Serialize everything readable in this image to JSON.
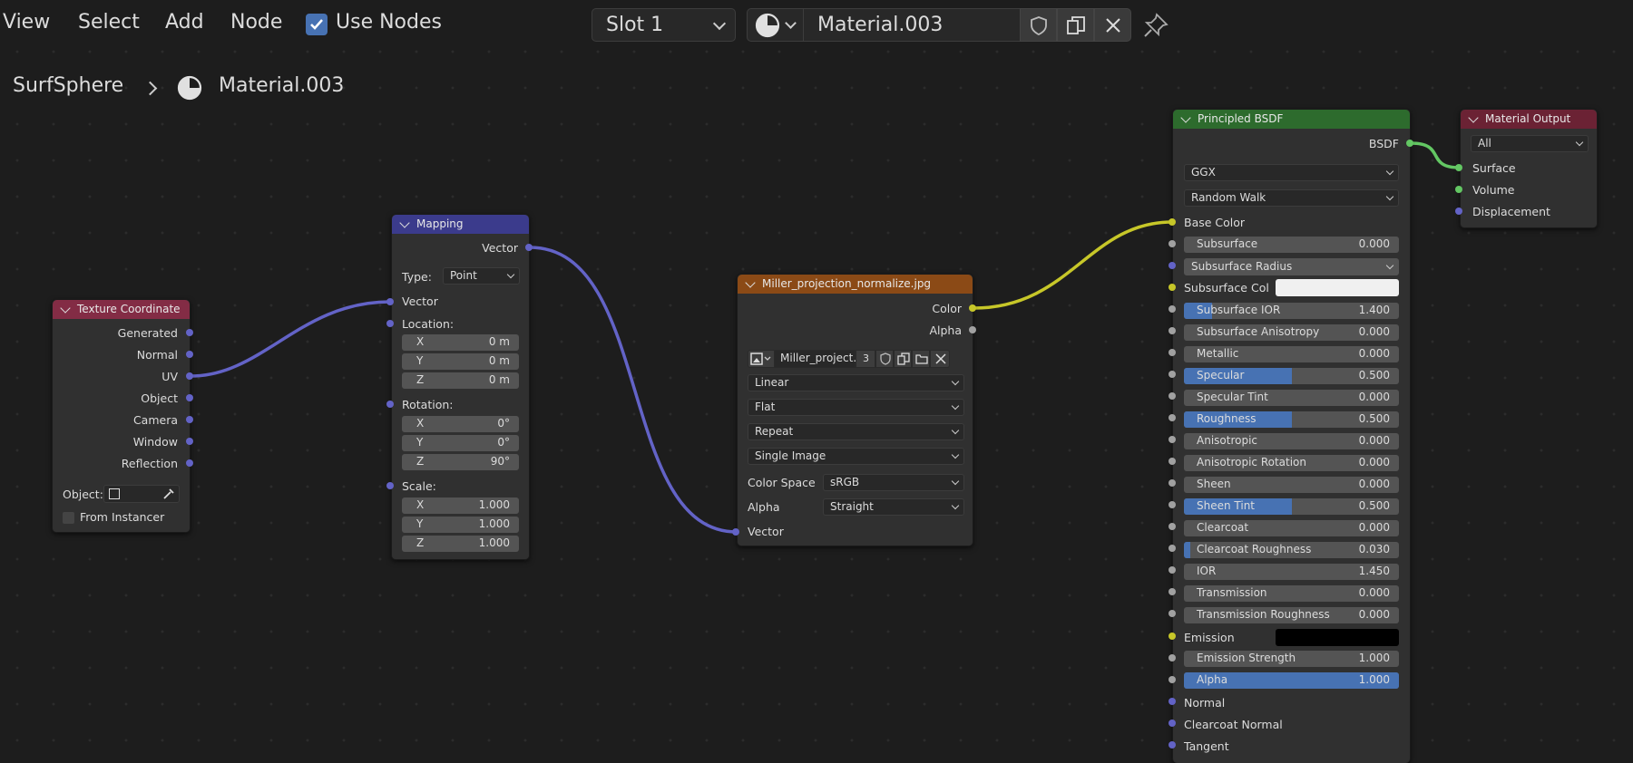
{
  "menu": {
    "view": "View",
    "select": "Select",
    "add": "Add",
    "node": "Node"
  },
  "use_nodes": {
    "label": "Use Nodes",
    "checked": true
  },
  "slot": {
    "label": "Slot 1"
  },
  "material_name": "Material.003",
  "breadcrumb": {
    "object": "SurfSphere",
    "material": "Material.003"
  },
  "nodes": {
    "texcoord": {
      "title": "Texture Coordinate",
      "outputs": [
        "Generated",
        "Normal",
        "UV",
        "Object",
        "Camera",
        "Window",
        "Reflection"
      ],
      "object_label": "Object:",
      "from_instancer": "From Instancer"
    },
    "mapping": {
      "title": "Mapping",
      "output": "Vector",
      "type_label": "Type:",
      "type_value": "Point",
      "vector_in": "Vector",
      "location_label": "Location:",
      "location": [
        {
          "axis": "X",
          "value": "0 m"
        },
        {
          "axis": "Y",
          "value": "0 m"
        },
        {
          "axis": "Z",
          "value": "0 m"
        }
      ],
      "rotation_label": "Rotation:",
      "rotation": [
        {
          "axis": "X",
          "value": "0°"
        },
        {
          "axis": "Y",
          "value": "0°"
        },
        {
          "axis": "Z",
          "value": "90°"
        }
      ],
      "scale_label": "Scale:",
      "scale": [
        {
          "axis": "X",
          "value": "1.000"
        },
        {
          "axis": "Y",
          "value": "1.000"
        },
        {
          "axis": "Z",
          "value": "1.000"
        }
      ]
    },
    "image": {
      "title": "Miller_projection_normalize.jpg",
      "out_color": "Color",
      "out_alpha": "Alpha",
      "image_name": "Miller_project...",
      "users": "3",
      "interpolation": "Linear",
      "projection": "Flat",
      "extension": "Repeat",
      "source": "Single Image",
      "color_space_label": "Color Space",
      "color_space": "sRGB",
      "alpha_label": "Alpha",
      "alpha": "Straight",
      "vector_in": "Vector"
    },
    "bsdf": {
      "title": "Principled BSDF",
      "output": "BSDF",
      "distribution": "GGX",
      "subsurface_method": "Random Walk",
      "base_color": "Base Color",
      "subsurface": {
        "label": "Subsurface",
        "value": "0.000"
      },
      "subsurface_radius": "Subsurface Radius",
      "subsurface_col": "Subsurface Col",
      "rows": [
        {
          "label": "Subsurface IOR",
          "value": "1.400",
          "fill": 0.13
        },
        {
          "label": "Subsurface Anisotropy",
          "value": "0.000",
          "fill": 0
        },
        {
          "label": "Metallic",
          "value": "0.000",
          "fill": 0
        },
        {
          "label": "Specular",
          "value": "0.500",
          "fill": 0.5
        },
        {
          "label": "Specular Tint",
          "value": "0.000",
          "fill": 0
        },
        {
          "label": "Roughness",
          "value": "0.500",
          "fill": 0.5
        },
        {
          "label": "Anisotropic",
          "value": "0.000",
          "fill": 0
        },
        {
          "label": "Anisotropic Rotation",
          "value": "0.000",
          "fill": 0
        },
        {
          "label": "Sheen",
          "value": "0.000",
          "fill": 0
        },
        {
          "label": "Sheen Tint",
          "value": "0.500",
          "fill": 0.5
        },
        {
          "label": "Clearcoat",
          "value": "0.000",
          "fill": 0
        },
        {
          "label": "Clearcoat Roughness",
          "value": "0.030",
          "fill": 0.03
        },
        {
          "label": "IOR",
          "value": "1.450",
          "fill": 0
        },
        {
          "label": "Transmission",
          "value": "0.000",
          "fill": 0
        },
        {
          "label": "Transmission Roughness",
          "value": "0.000",
          "fill": 0
        }
      ],
      "emission": "Emission",
      "emission_strength": {
        "label": "Emission Strength",
        "value": "1.000"
      },
      "alpha": {
        "label": "Alpha",
        "value": "1.000",
        "fill": 1
      },
      "normal": "Normal",
      "clearcoat_normal": "Clearcoat Normal",
      "tangent": "Tangent"
    },
    "output": {
      "title": "Material Output",
      "target": "All",
      "inputs": [
        "Surface",
        "Volume",
        "Displacement"
      ]
    }
  },
  "colors": {
    "header_texcoord": "#832c45",
    "header_mapping": "#3b3b8c",
    "header_image": "#8b4a16",
    "header_bsdf": "#2d6b2d",
    "header_output": "#6b2234",
    "accent": "#4772b3",
    "vector_socket": "#6363c7",
    "color_socket": "#c7c729",
    "float_socket": "#a1a1a1",
    "shader_socket": "#63c763"
  }
}
